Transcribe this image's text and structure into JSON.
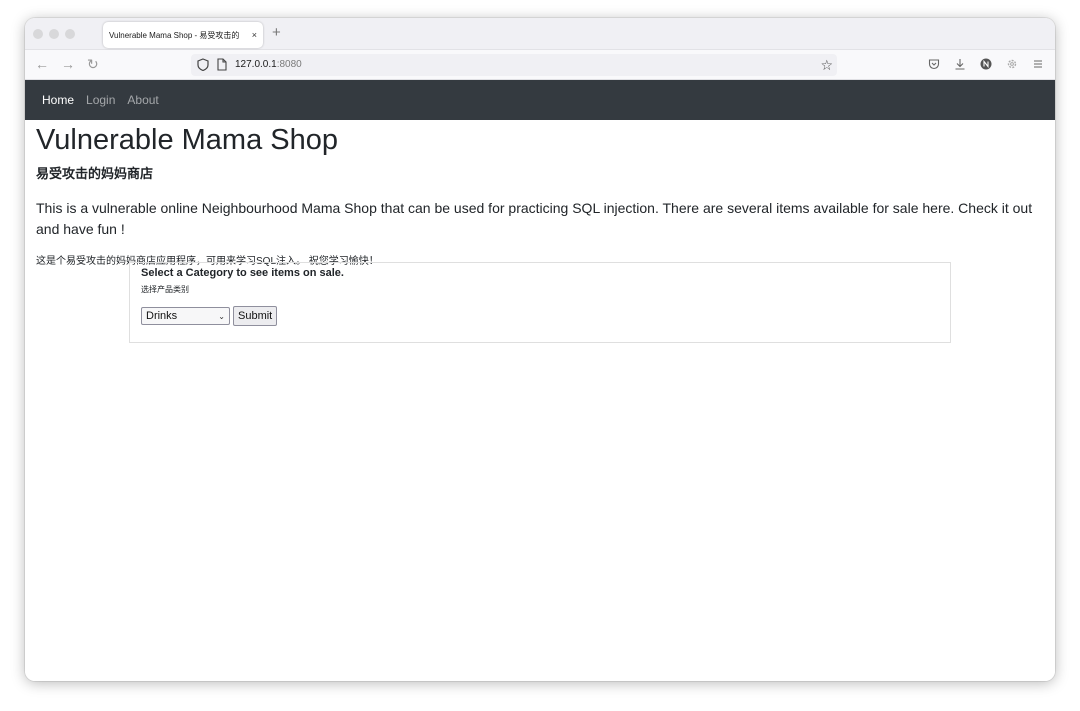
{
  "browser": {
    "tab_title": "Vulnerable Mama Shop - 易受攻击的",
    "tab_close": "×",
    "new_tab": "+",
    "url_host": "127.0.0.1",
    "url_port": ":8080",
    "nav": {
      "back": "←",
      "forward": "→",
      "reload": "↻"
    },
    "bookmark_star": "☆"
  },
  "site_nav": {
    "items": [
      {
        "label": "Home",
        "active": true
      },
      {
        "label": "Login",
        "active": false
      },
      {
        "label": "About",
        "active": false
      }
    ]
  },
  "main": {
    "title": "Vulnerable Mama Shop",
    "subtitle": "易受攻击的妈妈商店",
    "description_en": "This is a vulnerable online Neighbourhood Mama Shop that can be used for practicing SQL injection. There are several items available for sale here. Check it out and have fun !",
    "description_zh": "这是个易受攻击的妈妈商店应用程序，可用来学习SQL注入。 祝您学习愉快！"
  },
  "category_form": {
    "heading": "Select a Category to see items on sale.",
    "subheading": "选择产品类别",
    "selected_category": "Drinks",
    "submit_label": "Submit"
  },
  "colors": {
    "navbar_bg": "#343a40",
    "text": "#212529"
  }
}
